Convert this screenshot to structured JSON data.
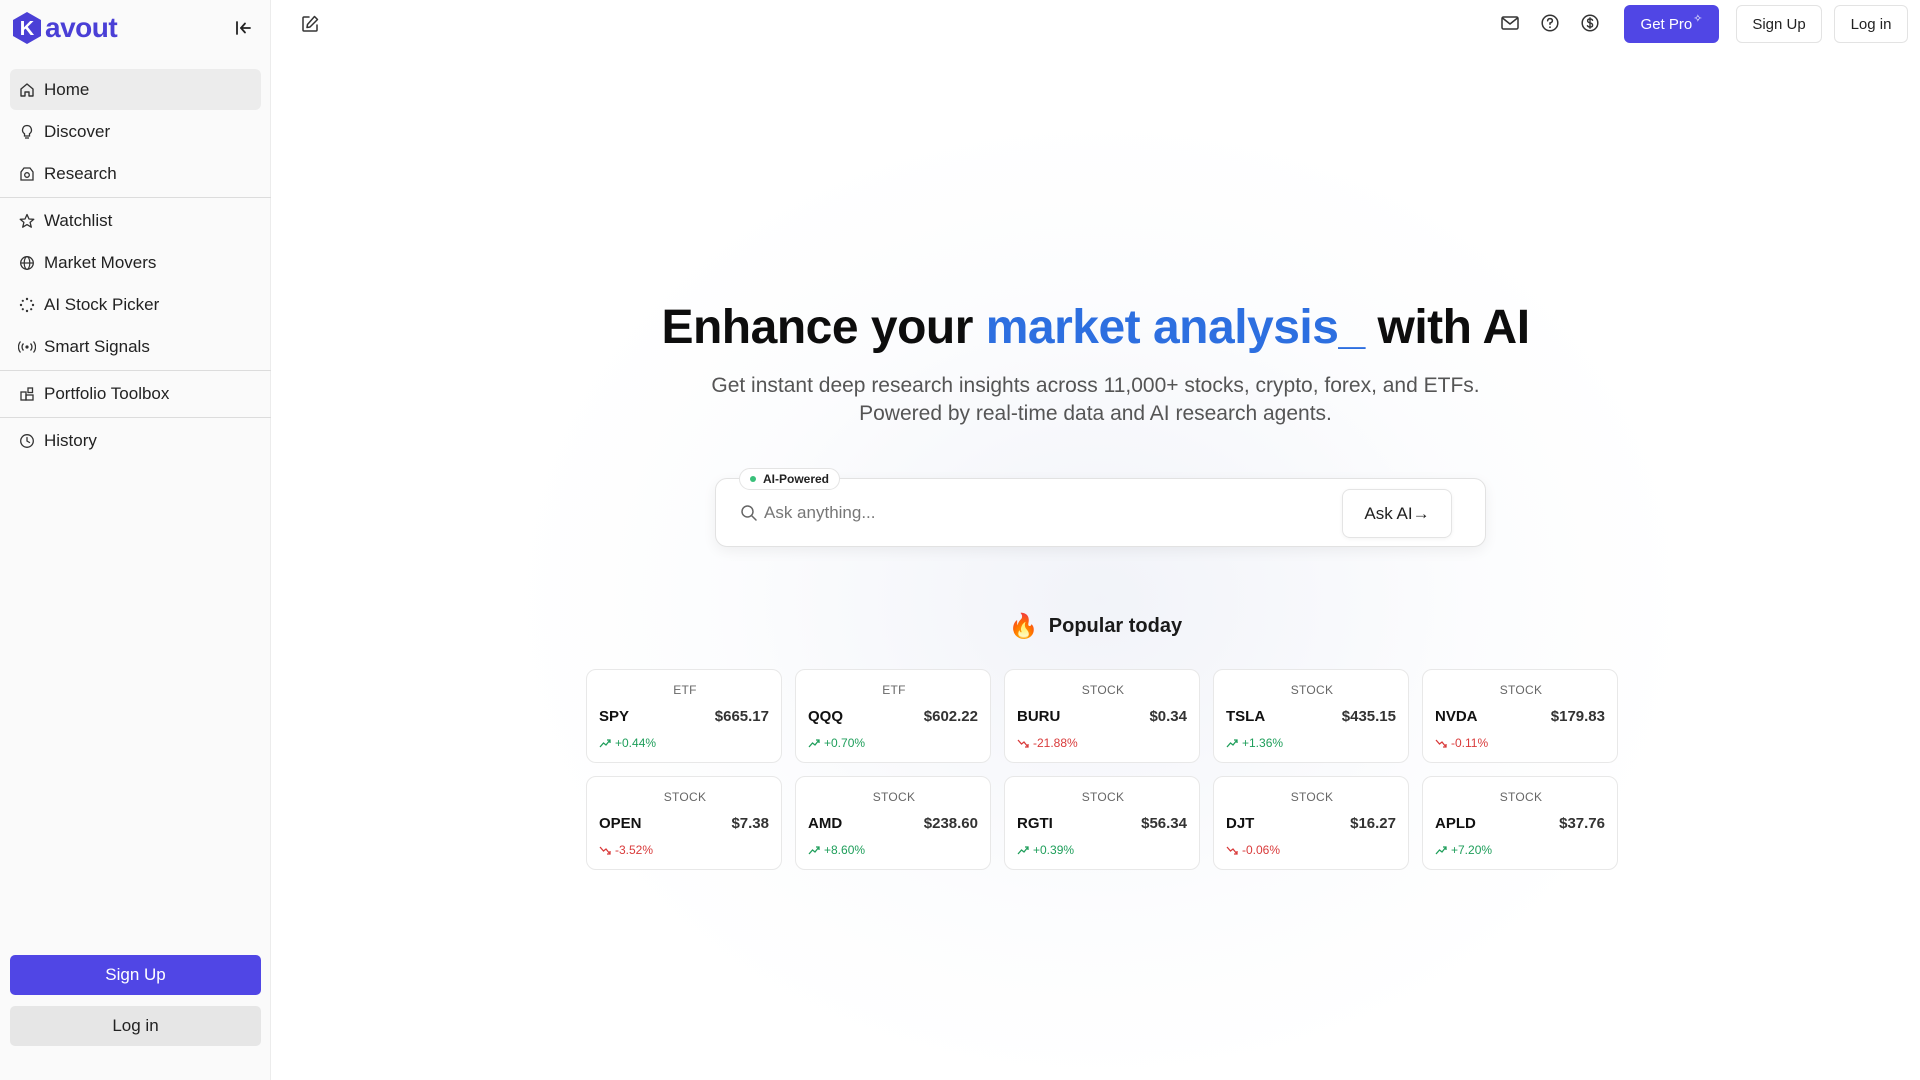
{
  "brand": {
    "logo_text": "avout",
    "logo_letter": "K"
  },
  "sidebar": {
    "items": [
      {
        "label": "Home",
        "icon": "home-icon",
        "active": true
      },
      {
        "label": "Discover",
        "icon": "lightbulb-icon"
      },
      {
        "label": "Research",
        "icon": "research-icon"
      },
      {
        "label": "Watchlist",
        "icon": "star-icon"
      },
      {
        "label": "Market Movers",
        "icon": "globe-icon"
      },
      {
        "label": "AI Stock Picker",
        "icon": "dots-circle-icon"
      },
      {
        "label": "Smart Signals",
        "icon": "signal-icon"
      },
      {
        "label": "Portfolio Toolbox",
        "icon": "toolbox-icon"
      },
      {
        "label": "History",
        "icon": "clock-icon"
      }
    ],
    "signup_label": "Sign Up",
    "login_label": "Log in"
  },
  "topbar": {
    "get_pro_label": "Get Pro",
    "signup_label": "Sign Up",
    "login_label": "Log in"
  },
  "hero": {
    "title_prefix": "Enhance your ",
    "title_accent": "market analysis",
    "title_cursor": "_",
    "title_suffix": " with AI",
    "subtitle_line1": "Get instant deep research insights across 11,000+ stocks, crypto, forex, and ETFs.",
    "subtitle_line2": "Powered by real-time data and AI research agents."
  },
  "search": {
    "badge": "AI-Powered",
    "placeholder": "Ask anything...",
    "value": "",
    "ask_label": "Ask AI",
    "ask_arrow": "→"
  },
  "popular": {
    "title": "Popular today",
    "flame": "🔥",
    "cards": [
      {
        "type": "ETF",
        "symbol": "SPY",
        "price": "$665.17",
        "change": "+0.44%",
        "direction": "up"
      },
      {
        "type": "ETF",
        "symbol": "QQQ",
        "price": "$602.22",
        "change": "+0.70%",
        "direction": "up"
      },
      {
        "type": "STOCK",
        "symbol": "BURU",
        "price": "$0.34",
        "change": "-21.88%",
        "direction": "down"
      },
      {
        "type": "STOCK",
        "symbol": "TSLA",
        "price": "$435.15",
        "change": "+1.36%",
        "direction": "up"
      },
      {
        "type": "STOCK",
        "symbol": "NVDA",
        "price": "$179.83",
        "change": "-0.11%",
        "direction": "down"
      },
      {
        "type": "STOCK",
        "symbol": "OPEN",
        "price": "$7.38",
        "change": "-3.52%",
        "direction": "down"
      },
      {
        "type": "STOCK",
        "symbol": "AMD",
        "price": "$238.60",
        "change": "+8.60%",
        "direction": "up"
      },
      {
        "type": "STOCK",
        "symbol": "RGTI",
        "price": "$56.34",
        "change": "+0.39%",
        "direction": "up"
      },
      {
        "type": "STOCK",
        "symbol": "DJT",
        "price": "$16.27",
        "change": "-0.06%",
        "direction": "down"
      },
      {
        "type": "STOCK",
        "symbol": "APLD",
        "price": "$37.76",
        "change": "+7.20%",
        "direction": "up"
      }
    ]
  },
  "colors": {
    "accent": "#5046e5",
    "headline_accent": "#2d6fe0",
    "up": "#1e9e5a",
    "down": "#d93a3a"
  }
}
